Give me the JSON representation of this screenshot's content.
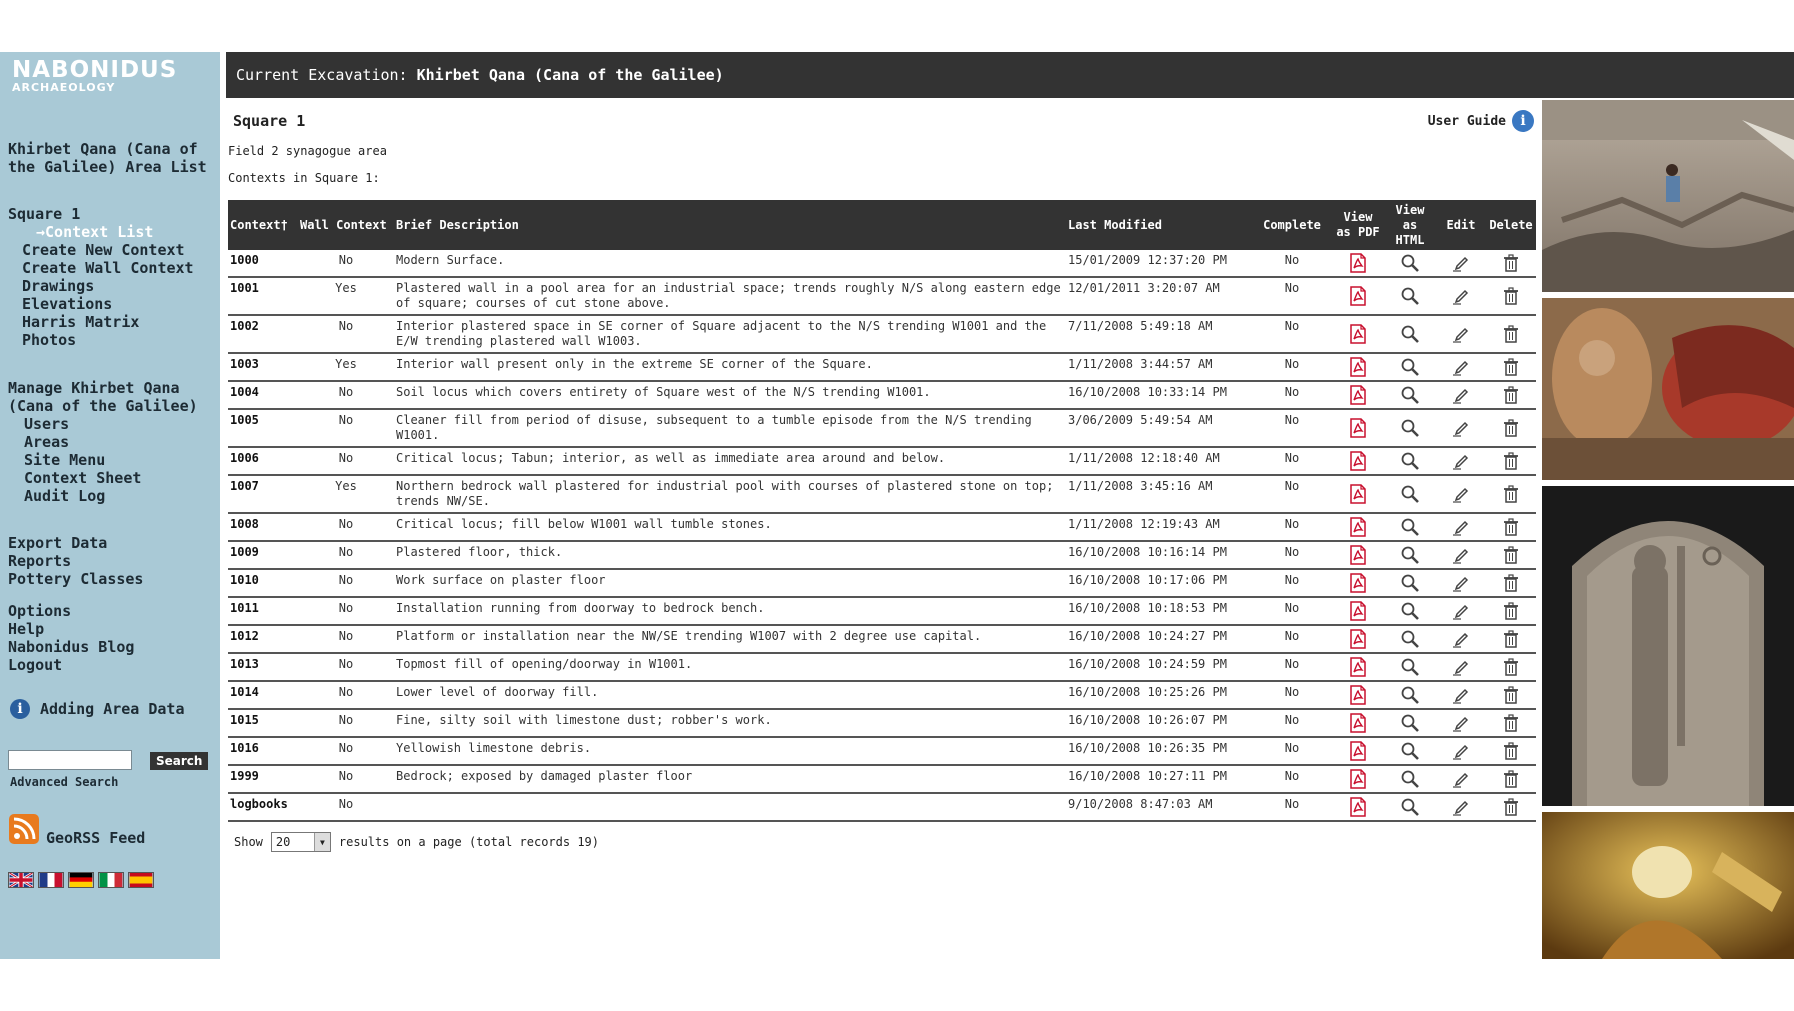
{
  "app": {
    "logo_main": "NABONIDUS",
    "logo_sub": "ARCHAEOLOGY"
  },
  "topbar": {
    "label": "Current Excavation:",
    "value": "Khirbet Qana (Cana of the Galilee)"
  },
  "sidebar": {
    "area_list": "Khirbet Qana (Cana of the Galilee) Area List",
    "square": "Square 1",
    "square_items": [
      "→Context List",
      "Create New Context",
      "Create Wall Context",
      "Drawings",
      "Elevations",
      "Harris Matrix",
      "Photos"
    ],
    "manage_title": "Manage Khirbet Qana (Cana of the Galilee)",
    "manage_items": [
      "Users",
      "Areas",
      "Site Menu",
      "Context Sheet",
      "Audit Log"
    ],
    "tools": [
      "Export Data",
      "Reports",
      "Pottery Classes"
    ],
    "misc": [
      "Options",
      "Help",
      "Nabonidus Blog",
      "Logout"
    ],
    "adding_area_data": "Adding Area Data",
    "search_value": "",
    "search_button": "Search",
    "advanced_search": "Advanced Search",
    "georss": "GeoRSS Feed",
    "flags": [
      "UK",
      "France",
      "Germany",
      "Italy",
      "Spain"
    ]
  },
  "main": {
    "square_title": "Square 1",
    "square_desc": "Field 2 synagogue area",
    "contexts_label": "Contexts in Square 1:",
    "user_guide": "User Guide",
    "columns": [
      "Context†",
      "Wall Context",
      "Brief Description",
      "Last Modified",
      "Complete",
      "View as PDF",
      "View as HTML",
      "Edit",
      "Delete"
    ],
    "rows": [
      {
        "id": "1000",
        "wall": "No",
        "desc": "Modern Surface.",
        "modified": "15/01/2009 12:37:20 PM",
        "complete": "No"
      },
      {
        "id": "1001",
        "wall": "Yes",
        "desc": "Plastered wall in a pool area for an industrial space; trends roughly N/S along eastern edge of square; courses of cut stone above.",
        "modified": "12/01/2011 3:20:07 AM",
        "complete": "No"
      },
      {
        "id": "1002",
        "wall": "No",
        "desc": "Interior plastered space in SE corner of Square adjacent to the N/S trending W1001 and the E/W trending plastered wall W1003.",
        "modified": "7/11/2008 5:49:18 AM",
        "complete": "No"
      },
      {
        "id": "1003",
        "wall": "Yes",
        "desc": "Interior wall present only in the extreme SE corner of the Square.",
        "modified": "1/11/2008 3:44:57 AM",
        "complete": "No"
      },
      {
        "id": "1004",
        "wall": "No",
        "desc": "Soil locus which covers entirety of Square west of the N/S trending W1001.",
        "modified": "16/10/2008 10:33:14 PM",
        "complete": "No"
      },
      {
        "id": "1005",
        "wall": "No",
        "desc": "Cleaner fill from period of disuse, subsequent to a tumble episode from the N/S trending W1001.",
        "modified": "3/06/2009 5:49:54 AM",
        "complete": "No"
      },
      {
        "id": "1006",
        "wall": "No",
        "desc": "Critical locus; Tabun; interior, as well as immediate area around and below.",
        "modified": "1/11/2008 12:18:40 AM",
        "complete": "No"
      },
      {
        "id": "1007",
        "wall": "Yes",
        "desc": "Northern bedrock wall plastered for industrial pool with courses of plastered stone on top; trends NW/SE.",
        "modified": "1/11/2008 3:45:16 AM",
        "complete": "No"
      },
      {
        "id": "1008",
        "wall": "No",
        "desc": "Critical locus; fill below W1001 wall tumble stones.",
        "modified": "1/11/2008 12:19:43 AM",
        "complete": "No"
      },
      {
        "id": "1009",
        "wall": "No",
        "desc": "Plastered floor, thick.",
        "modified": "16/10/2008 10:16:14 PM",
        "complete": "No"
      },
      {
        "id": "1010",
        "wall": "No",
        "desc": "Work surface on plaster floor",
        "modified": "16/10/2008 10:17:06 PM",
        "complete": "No"
      },
      {
        "id": "1011",
        "wall": "No",
        "desc": "Installation running from doorway to bedrock bench.",
        "modified": "16/10/2008 10:18:53 PM",
        "complete": "No"
      },
      {
        "id": "1012",
        "wall": "No",
        "desc": "Platform or installation near the NW/SE trending W1007 with 2 degree use capital.",
        "modified": "16/10/2008 10:24:27 PM",
        "complete": "No"
      },
      {
        "id": "1013",
        "wall": "No",
        "desc": "Topmost fill of opening/doorway in W1001.",
        "modified": "16/10/2008 10:24:59 PM",
        "complete": "No"
      },
      {
        "id": "1014",
        "wall": "No",
        "desc": "Lower level of doorway fill.",
        "modified": "16/10/2008 10:25:26 PM",
        "complete": "No"
      },
      {
        "id": "1015",
        "wall": "No",
        "desc": "Fine, silty soil with limestone dust; robber's work.",
        "modified": "16/10/2008 10:26:07 PM",
        "complete": "No"
      },
      {
        "id": "1016",
        "wall": "No",
        "desc": "Yellowish limestone debris.",
        "modified": "16/10/2008 10:26:35 PM",
        "complete": "No"
      },
      {
        "id": "1999",
        "wall": "No",
        "desc": "Bedrock; exposed by damaged plaster floor",
        "modified": "16/10/2008 10:27:11 PM",
        "complete": "No"
      },
      {
        "id": "logbooks",
        "wall": "No",
        "desc": "",
        "modified": "9/10/2008 8:47:03 AM",
        "complete": "No"
      }
    ],
    "pager": {
      "show_label": "Show",
      "page_size": "20",
      "suffix": "results on a page (total records 19)"
    }
  },
  "colors": {
    "sidebar_bg": "#a9c9d6",
    "header_bg": "#333333",
    "pdf_red": "#c8102e",
    "link_white": "#ffffff"
  },
  "icons": [
    "pdf-icon",
    "magnifier-icon",
    "pencil-icon",
    "trash-icon",
    "info-icon",
    "rss-icon"
  ]
}
